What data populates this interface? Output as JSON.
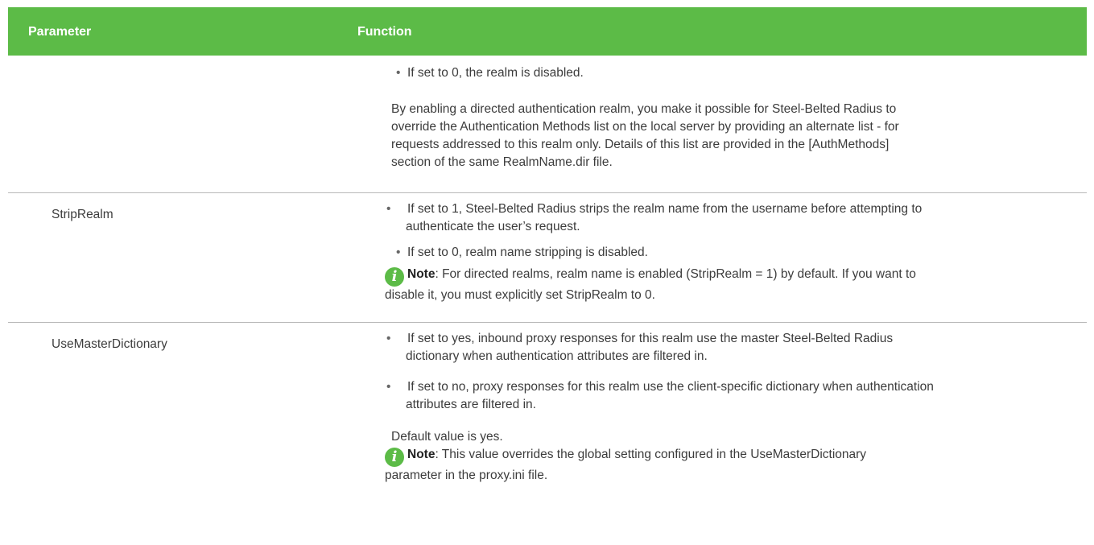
{
  "header": {
    "param": "Parameter",
    "function": "Function"
  },
  "row1": {
    "bullet1": "If set to 0, the realm is disabled.",
    "para": "By enabling a directed authentication realm, you make it possible for Steel-Belted Radius to override the Authentication Methods list on the local server by providing an alternate list - for requests addressed to this realm only. Details of this list are provided in the [AuthMethods] section of the same RealmName.dir file."
  },
  "row2": {
    "param": "StripRealm",
    "bullet1": "If set to 1, Steel-Belted Radius strips the realm name from the username before attempting to authenticate the user’s request.",
    "bullet2": "If set to 0, realm name stripping is disabled.",
    "note_label": "Note",
    "note_text": ": For directed realms, realm name is enabled (StripRealm = 1) by default. If you   want to disable it, you must explicitly set StripRealm to 0."
  },
  "row3": {
    "param": "UseMasterDictionary",
    "bullet1": "If set to yes, inbound proxy responses for this realm use the master Steel-Belted Radius dictionary when authentication attributes are filtered in.",
    "bullet2": "If set to no, proxy responses for this realm use the client-specific dictionary when authentication attributes are filtered in.",
    "default": "Default value is yes.",
    "note_label": "Note",
    "note_text": ": This value overrides the global setting configured in the UseMasterDictionary  parameter in the proxy.ini file."
  },
  "icons": {
    "note": "info-icon",
    "bullet": "bullet-dot"
  },
  "colors": {
    "header_bg": "#5cbb47",
    "note_icon": "#5cbb47"
  }
}
